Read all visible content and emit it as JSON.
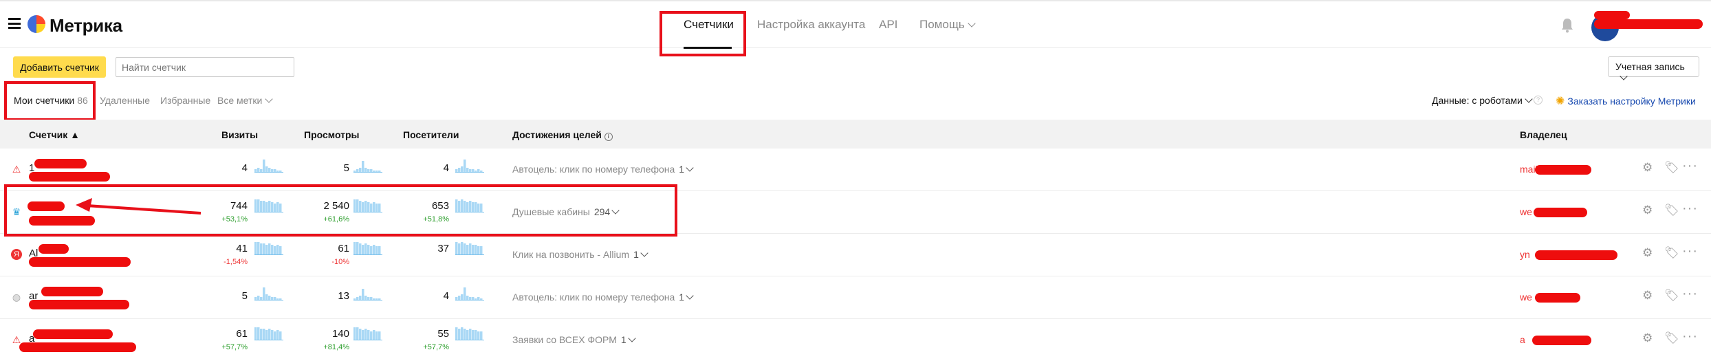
{
  "header": {
    "logo_text": "Метрика",
    "nav": [
      {
        "label": "Счетчики",
        "active": true
      },
      {
        "label": "Настройка аккаунта",
        "active": false
      },
      {
        "label": "API",
        "active": false
      },
      {
        "label": "Помощь",
        "active": false
      }
    ]
  },
  "toolbar": {
    "add_button": "Добавить счетчик",
    "search_placeholder": "Найти счетчик",
    "account_select": "Учетная запись"
  },
  "tabs": [
    {
      "label": "Мои счетчики",
      "count": "86",
      "active": true
    },
    {
      "label": "Удаленные",
      "active": false
    },
    {
      "label": "Избранные",
      "active": false
    },
    {
      "label": "Все метки",
      "active": false
    }
  ],
  "data_mode": "Данные: с роботами",
  "order_link": "Заказать настройку Метрики",
  "columns": {
    "counter": "Счетчик ▲",
    "visits": "Визиты",
    "views": "Просмотры",
    "visitors": "Посетители",
    "goals": "Достижения целей",
    "owner": "Владелец"
  },
  "rows": [
    {
      "name": "1",
      "icon": "warning-icon",
      "visits": "4",
      "visits_delta": "",
      "views": "5",
      "views_delta": "",
      "visitors": "4",
      "visitors_delta": "",
      "goal": "Автоцель: клик по номеру телефона",
      "goal_count": "1",
      "owner": "mail"
    },
    {
      "name": "",
      "icon": "crown-icon",
      "visits": "744",
      "visits_delta": "+53,1%",
      "views": "2 540",
      "views_delta": "+61,6%",
      "visitors": "653",
      "visitors_delta": "+51,8%",
      "goal": "Душевые кабины",
      "goal_count": "294",
      "owner": "we"
    },
    {
      "name": "Al",
      "icon": "yandex-icon",
      "visits": "41",
      "visits_delta": "-1,54%",
      "views": "61",
      "views_delta": "-10%",
      "visitors": "37",
      "visitors_delta": "",
      "goal": "Клик на позвонить - Allium",
      "goal_count": "1",
      "owner": "yn"
    },
    {
      "name": "ar",
      "icon": "globe-icon",
      "visits": "5",
      "visits_delta": "",
      "views": "13",
      "views_delta": "",
      "visitors": "4",
      "visitors_delta": "",
      "goal": "Автоцель: клик по номеру телефона",
      "goal_count": "1",
      "owner": "we"
    },
    {
      "name": "a",
      "icon": "warning-icon",
      "visits": "61",
      "visits_delta": "+57,7%",
      "views": "140",
      "views_delta": "+81,4%",
      "visitors": "55",
      "visitors_delta": "+57,7%",
      "goal": "Заявки со ВСЕХ ФОРМ",
      "goal_count": "1",
      "owner": "a"
    }
  ],
  "colors": {
    "accent_yellow": "#ffdb4d",
    "link_blue": "#1a4bb0",
    "annotation_red": "#e8101a",
    "spark_blue": "#a9d8f5"
  }
}
